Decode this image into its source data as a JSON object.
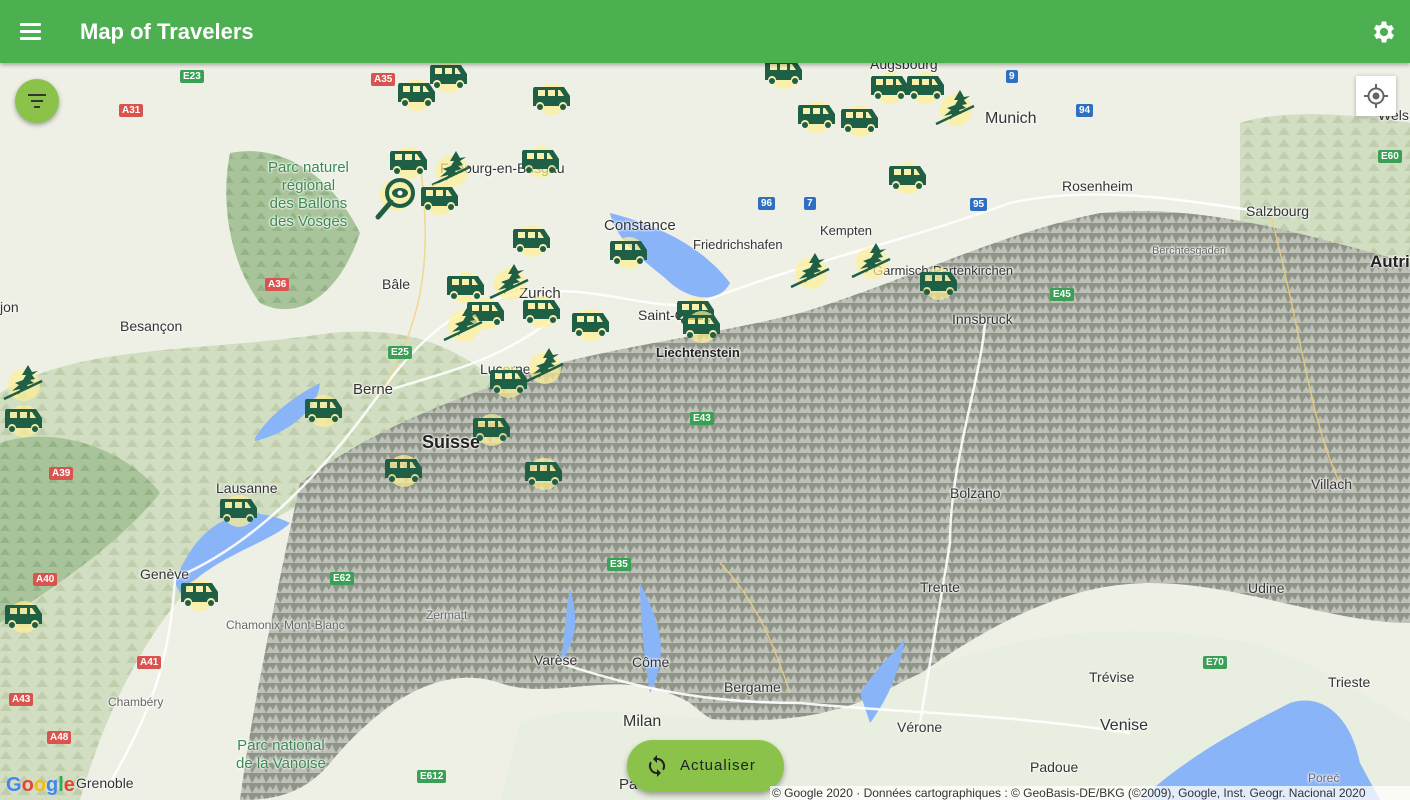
{
  "app": {
    "title": "Map of Travelers",
    "menu_icon": "hamburger-menu-icon",
    "settings_icon": "gear-icon"
  },
  "map": {
    "cities": [
      {
        "name": "Augsbourg"
      },
      {
        "name": "Munich"
      },
      {
        "name": "Rosenheim"
      },
      {
        "name": "Salzbourg"
      },
      {
        "name": "Wels"
      },
      {
        "name": "Fribourg-en-Brisgau"
      },
      {
        "name": "Constance"
      },
      {
        "name": "Friedrichshafen"
      },
      {
        "name": "Kempten"
      },
      {
        "name": "Garmisch-Partenkirchen"
      },
      {
        "name": "Berchtesgaden"
      },
      {
        "name": "Autri"
      },
      {
        "name": "Bâle"
      },
      {
        "name": "Zurich"
      },
      {
        "name": "Saint-Gall"
      },
      {
        "name": "Liechtenstein"
      },
      {
        "name": "Innsbruck"
      },
      {
        "name": "Besançon"
      },
      {
        "name": "jon"
      },
      {
        "name": "Berne"
      },
      {
        "name": "Lucerne"
      },
      {
        "name": "Suisse"
      },
      {
        "name": "Lausanne"
      },
      {
        "name": "Genève"
      },
      {
        "name": "Chamonix-Mont-Blanc"
      },
      {
        "name": "Zermatt"
      },
      {
        "name": "Bolzano"
      },
      {
        "name": "Villach"
      },
      {
        "name": "Trente"
      },
      {
        "name": "Udine"
      },
      {
        "name": "Varèse"
      },
      {
        "name": "Côme"
      },
      {
        "name": "Bergame"
      },
      {
        "name": "Chambéry"
      },
      {
        "name": "Trévise"
      },
      {
        "name": "Trieste"
      },
      {
        "name": "Milan"
      },
      {
        "name": "Vérone"
      },
      {
        "name": "Venise"
      },
      {
        "name": "Padoue"
      },
      {
        "name": "Grenoble"
      },
      {
        "name": "Poreč"
      },
      {
        "name": "Pa"
      }
    ],
    "parks": [
      {
        "name": "Parc naturel\nrégional\ndes Ballons\ndes Vosges"
      },
      {
        "name": "Parc national\nde la Vanoise"
      }
    ],
    "roads": [
      "E23",
      "A35",
      "A31",
      "9",
      "94",
      "E60",
      "96",
      "7",
      "95",
      "A36",
      "E45",
      "E25",
      "E43",
      "A39",
      "E62",
      "A40",
      "E35",
      "A41",
      "E70",
      "A43",
      "A48",
      "E612"
    ],
    "marker_icons": [
      "van-icon",
      "witch-icon",
      "magnifier-eye-icon"
    ]
  },
  "controls": {
    "filter_icon": "filter-icon",
    "locate_icon": "my-location-icon",
    "refresh_label": "Actualiser",
    "refresh_icon": "refresh-icon"
  },
  "footer": {
    "google_logo": "Google",
    "attribution": "© Google 2020 · Données cartographiques : © GeoBasis-DE/BKG (©2009), Google, Inst. Geogr. Nacional 2020"
  },
  "colors": {
    "appbar": "#4caf50",
    "fab": "#8bc34a",
    "marker": "#1f5f45"
  }
}
